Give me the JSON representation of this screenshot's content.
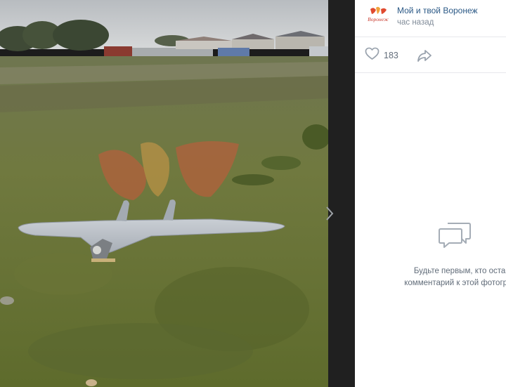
{
  "post": {
    "group_name": "Мой и твой Воронеж",
    "time": "час назад",
    "avatar_text": "Воронеж",
    "likes": "183"
  },
  "comments": {
    "empty_line1": "Будьте первым, кто оставит",
    "empty_line2": "комментарий к этой фотографии"
  },
  "icons": [
    "heart-icon",
    "share-arrow-icon",
    "comment-bubble-icon",
    "chevron-right-icon"
  ],
  "colors": {
    "link": "#2a5885",
    "muted": "#818c99",
    "icon": "#99a2ad",
    "lightbox_bg": "#202020"
  }
}
